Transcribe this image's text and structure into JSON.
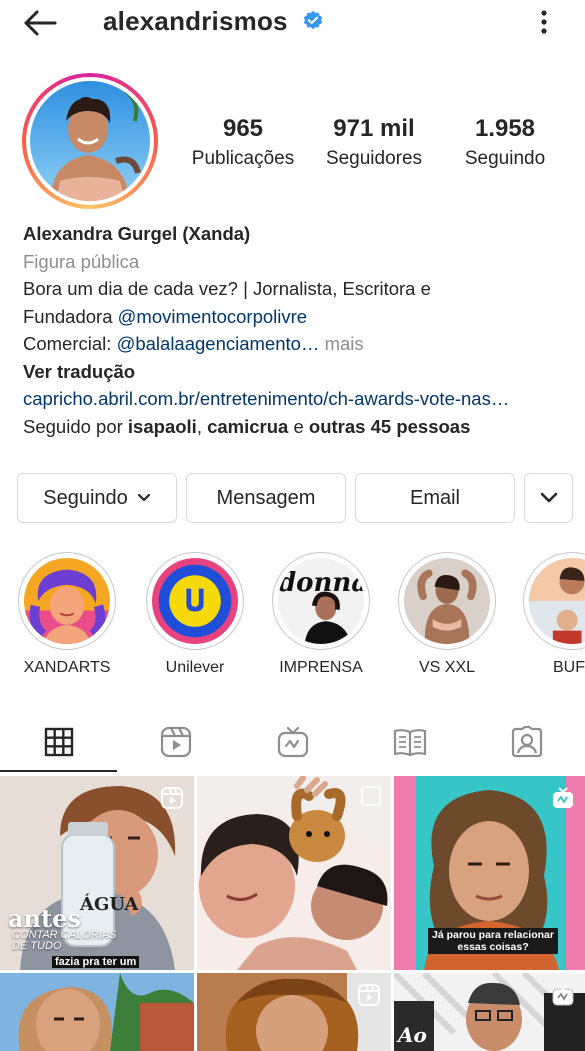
{
  "header": {
    "username": "alexandrismos"
  },
  "profile": {
    "stats": [
      {
        "value": "965",
        "label": "Publicações"
      },
      {
        "value": "971 mil",
        "label": "Seguidores"
      },
      {
        "value": "1.958",
        "label": "Seguindo"
      }
    ],
    "name": "Alexandra Gurgel (Xanda)",
    "category": "Figura pública",
    "bio_line1": "Bora um dia de cada vez? | Jornalista, Escritora e",
    "bio_line2_text": "Fundadora ",
    "bio_line2_mention": "@movimentocorpolivre",
    "bio_line3_text": "Comercial: ",
    "bio_line3_mention": "@balalaagenciamento…",
    "bio_more": " mais",
    "translate": "Ver tradução",
    "link": "capricho.abril.com.br/entretenimento/ch-awards-vote-nas…",
    "followed_prefix": "Seguido por ",
    "followed_user1": "isapaoli",
    "followed_sep": ", ",
    "followed_user2": "camicrua",
    "followed_mid": " e ",
    "followed_others": "outras 45 pessoas"
  },
  "actions": {
    "following": "Seguindo",
    "message": "Mensagem",
    "email": "Email"
  },
  "highlights": [
    {
      "label": "XANDARTS"
    },
    {
      "label": "Unilever"
    },
    {
      "label": "IMPRENSA",
      "cover_text": "donna"
    },
    {
      "label": "VS XXL"
    },
    {
      "label": "BUF"
    }
  ],
  "tabs": [
    {
      "icon": "grid-icon"
    },
    {
      "icon": "reels-icon"
    },
    {
      "icon": "igtv-icon"
    },
    {
      "icon": "guides-icon"
    },
    {
      "icon": "tagged-icon"
    }
  ],
  "posts": [
    {
      "title": "antes",
      "subtitle": "CONTAR CALORIAS DE TUDO",
      "caption": "fazia pra ter um",
      "bottle_text": "ÁGUA"
    },
    {},
    {
      "caption": "Já parou para relacionar essas coisas?"
    },
    {},
    {},
    {
      "caption": "Ao"
    }
  ],
  "colors": {
    "accent_link": "#00376b",
    "secondary_text": "#8e8e8e",
    "border": "#dbdbdb",
    "verified_blue": "#3897f0"
  }
}
